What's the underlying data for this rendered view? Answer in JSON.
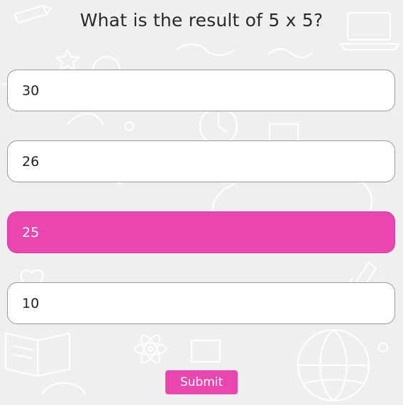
{
  "quiz": {
    "question": "What is the result of 5 x 5?",
    "options": [
      {
        "label": "30",
        "selected": false
      },
      {
        "label": "26",
        "selected": false
      },
      {
        "label": "25",
        "selected": true
      },
      {
        "label": "10",
        "selected": false
      }
    ],
    "submit_label": "Submit"
  },
  "theme": {
    "accent": "#e946b0",
    "background": "#efefef",
    "option_background": "#ffffff",
    "option_border": "#9a9a9a"
  },
  "background_icons": [
    "globe-icon",
    "book-icon",
    "pencil-icon",
    "clock-icon",
    "lightbulb-icon",
    "atom-icon",
    "star-icon",
    "heart-icon",
    "laptop-icon",
    "rocket-icon"
  ]
}
